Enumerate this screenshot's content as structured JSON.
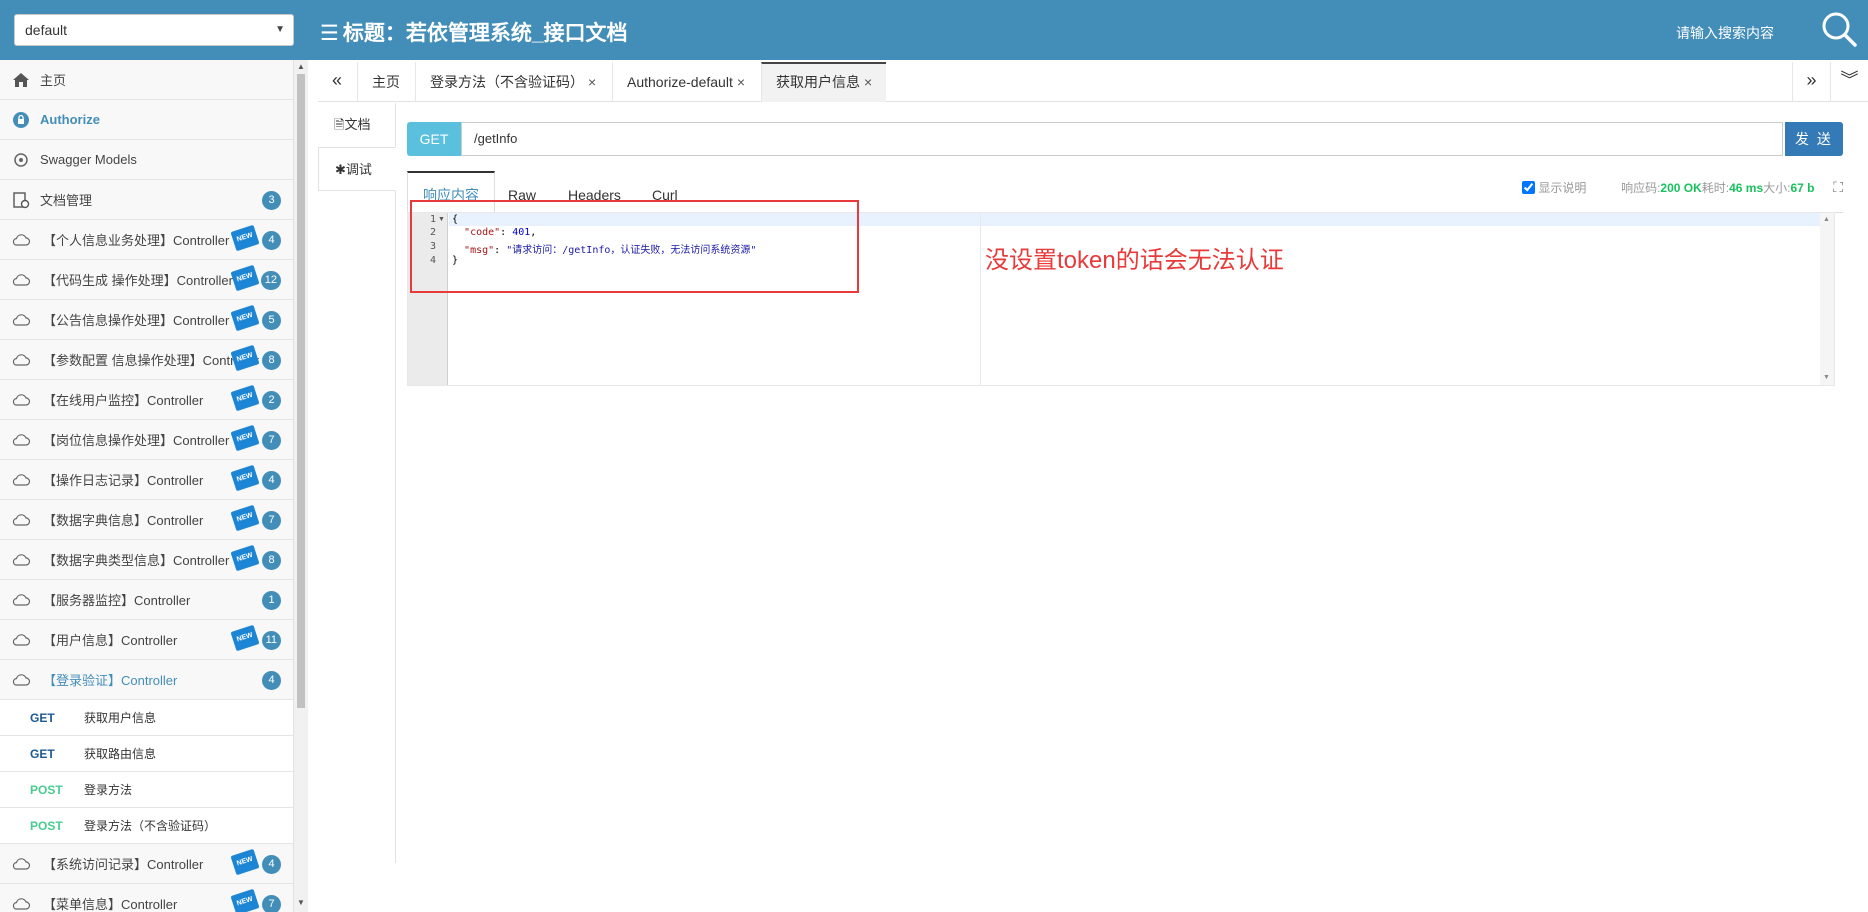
{
  "header": {
    "group_select": "default",
    "title_icon": "☰",
    "title": "标题：若依管理系统_接口文档",
    "search_placeholder": "请输入搜索内容"
  },
  "sidebar": {
    "top_items": [
      {
        "label": "主页",
        "icon": "home-icon"
      },
      {
        "label": "Authorize",
        "icon": "lock-icon"
      },
      {
        "label": "Swagger Models",
        "icon": "cubes-icon"
      },
      {
        "label": "文档管理",
        "icon": "doc-settings-icon",
        "count": "3"
      }
    ],
    "controllers": [
      {
        "label": "【个人信息业务处理】Controller",
        "new": "NEW",
        "count": "4"
      },
      {
        "label": "【代码生成 操作处理】Controller",
        "new": "NEW",
        "count": "12"
      },
      {
        "label": "【公告信息操作处理】Controller",
        "new": "NEW",
        "count": "5"
      },
      {
        "label": "【参数配置 信息操作处理】Controller",
        "new": "NEW",
        "count": "8"
      },
      {
        "label": "【在线用户监控】Controller",
        "new": "NEW",
        "count": "2"
      },
      {
        "label": "【岗位信息操作处理】Controller",
        "new": "NEW",
        "count": "7"
      },
      {
        "label": "【操作日志记录】Controller",
        "new": "NEW",
        "count": "4"
      },
      {
        "label": "【数据字典信息】Controller",
        "new": "NEW",
        "count": "7"
      },
      {
        "label": "【数据字典类型信息】Controller",
        "new": "NEW",
        "count": "8"
      },
      {
        "label": "【服务器监控】Controller",
        "new": "",
        "count": "1"
      },
      {
        "label": "【用户信息】Controller",
        "new": "NEW",
        "count": "11"
      },
      {
        "label": "【登录验证】Controller",
        "new": "",
        "count": "4"
      }
    ],
    "apis": [
      {
        "method": "GET",
        "label": "获取用户信息"
      },
      {
        "method": "GET",
        "label": "获取路由信息"
      },
      {
        "method": "POST",
        "label": "登录方法"
      },
      {
        "method": "POST",
        "label": "登录方法（不含验证码）"
      }
    ],
    "bottom_controllers": [
      {
        "label": "【系统访问记录】Controller",
        "new": "NEW",
        "count": "4"
      },
      {
        "label": "【菜单信息】Controller",
        "new": "NEW",
        "count": "7"
      }
    ]
  },
  "tabs": [
    {
      "label": "主页",
      "closable": false
    },
    {
      "label": "登录方法（不含验证码）",
      "closable": true
    },
    {
      "label": "Authorize-default",
      "closable": true
    },
    {
      "label": "获取用户信息",
      "closable": true
    }
  ],
  "tab_nav": {
    "prev": "«",
    "next": "»",
    "menu": "︾"
  },
  "close_glyph": "×",
  "subnav": {
    "doc": "文档",
    "debug": "调试"
  },
  "request": {
    "method": "GET",
    "url": "/getInfo",
    "send": "发 送"
  },
  "response": {
    "tabs": [
      "响应内容",
      "Raw",
      "Headers",
      "Curl"
    ],
    "show_desc": "显示说明",
    "code_label": "响应码:",
    "code_value": "200 OK",
    "time_label": "耗时:",
    "time_value": "46 ms",
    "size_label": "大小:",
    "size_value": "67 b",
    "lines": [
      "1",
      "2",
      "3",
      "4"
    ],
    "code": {
      "open": "{",
      "code_key": "\"code\"",
      "code_val": "401",
      "msg_key": "\"msg\"",
      "msg_val": "\"请求访问：/getInfo，认证失败，无法访问系统资源\"",
      "close": "}"
    }
  },
  "annotation": "没设置token的话会无法认证",
  "colors": {
    "header": "#438eb9",
    "accent": "#438eb9",
    "annotation": "#e83a3a",
    "get_badge": "#5bc0de",
    "send": "#337ab7"
  }
}
